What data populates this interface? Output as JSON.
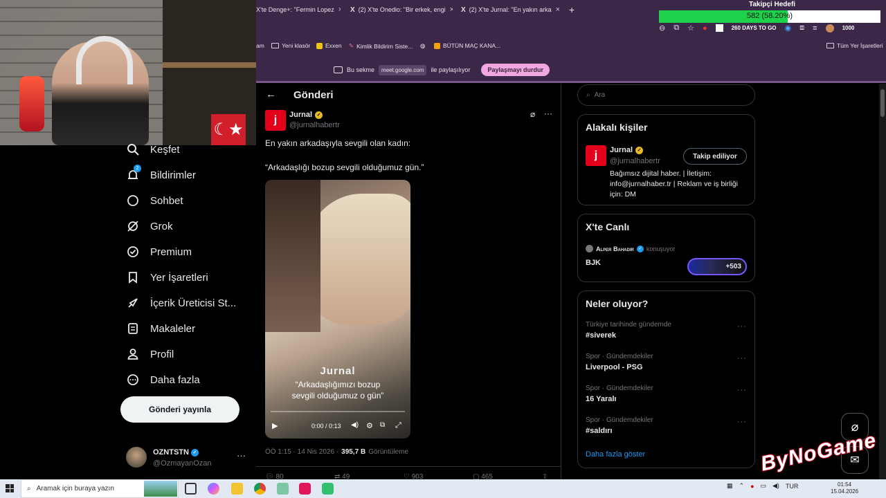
{
  "goal": {
    "title": "Takipçi Hedefi",
    "value_text": "582 (58.20%)",
    "progress": 0.582,
    "color": "#1ed14b"
  },
  "tabs": [
    {
      "label": "X'te Denge+: \"Fermin Lopez"
    },
    {
      "label": "(2) X'te Onedio: \"Bir erkek, engi"
    },
    {
      "label": "(2) X'te Jurnal: \"En yakın arka"
    }
  ],
  "extensions": {
    "days_badge": "260 DAYS TO GO",
    "counter": "1000"
  },
  "bookmarks": [
    "am",
    "Yeni klasör",
    "Exxen",
    "Kimlik Bildirim Siste...",
    "BÜTÜN MAÇ KANA...",
    "Tüm Yer İşaretleri"
  ],
  "share": {
    "prefix": "Bu sekme",
    "domain": "meet.google.com",
    "suffix": "ile paylaşılıyor",
    "stop_button": "Paylaşmayı durdur"
  },
  "sidebar": {
    "items": [
      {
        "label": "Keşfet",
        "icon": "search-icon"
      },
      {
        "label": "Bildirimler",
        "icon": "bell-icon",
        "badge": "2"
      },
      {
        "label": "Sohbet",
        "icon": "chat-icon"
      },
      {
        "label": "Grok",
        "icon": "grok-icon"
      },
      {
        "label": "Premium",
        "icon": "premium-icon"
      },
      {
        "label": "Yer İşaretleri",
        "icon": "bookmark-icon"
      },
      {
        "label": "İçerik Üreticisi St...",
        "icon": "rocket-icon"
      },
      {
        "label": "Makaleler",
        "icon": "article-icon"
      },
      {
        "label": "Profil",
        "icon": "profile-icon"
      },
      {
        "label": "Daha fazla",
        "icon": "more-circle-icon"
      }
    ],
    "post_button": "Gönderi yayınla",
    "account": {
      "name": "OZNTSTN",
      "handle": "@OzmayanOzan"
    }
  },
  "post": {
    "header": "Gönderi",
    "author_name": "Jurnal",
    "author_handle": "@jurnalhabertr",
    "text1": "En yakın arkadaşıyla sevgili olan kadın:",
    "text2": "“Arkadaşlığı bozup sevgili olduğumuz gün.”",
    "video": {
      "watermark": "Jurnal",
      "caption1": "“Arkadaşlığımızı bozup",
      "caption2": "sevgili olduğumuz o gün”",
      "time": "0:00 / 0:13",
      "progress": 0.0
    },
    "meta_time": "ÖÖ 1:15 · 14 Nis 2026 ·",
    "views": "395,7 B",
    "views_label": "Görüntüleme",
    "actions": [
      "80",
      "49",
      "903",
      "465"
    ]
  },
  "search": {
    "placeholder": "Ara"
  },
  "related": {
    "title": "Alakalı kişiler",
    "name": "Jurnal",
    "handle": "@jurnalhabertr",
    "follow": "Takip ediliyor",
    "bio": "Bağımsız dijital haber. | İletişim: info@jurnalhaber.tr | Reklam ve iş birliği için: DM"
  },
  "live": {
    "title": "X'te Canlı",
    "host": "Alper Bahadır",
    "status": "konuşuyor",
    "topic": "BJK",
    "count": "+503"
  },
  "trends": {
    "title": "Neler oluyor?",
    "items": [
      {
        "meta": "Türkiye tarihinde gündemde",
        "tag": "#siverek"
      },
      {
        "meta": "Spor · Gündemdekiler",
        "tag": "Liverpool - PSG"
      },
      {
        "meta": "Spor · Gündemdekiler",
        "tag": "16 Yaralı"
      },
      {
        "meta": "Spor · Gündemdekiler",
        "tag": "#saldırı"
      }
    ],
    "show_more": "Daha fazla göster"
  },
  "overlay": {
    "brand": "ByNoGame"
  },
  "taskbar": {
    "search": "Aramak için buraya yazın",
    "lang": "TUR",
    "time": "01:54",
    "date": "15.04.2026"
  }
}
